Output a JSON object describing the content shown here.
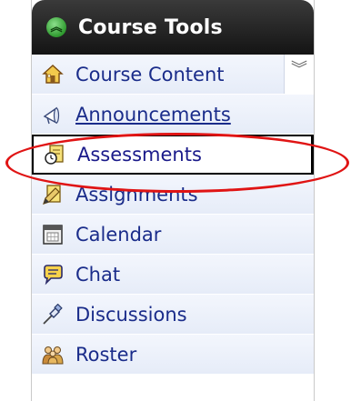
{
  "header": {
    "title": "Course Tools",
    "collapse_icon": "double-chevron-up-icon",
    "collapse_glyph": "︽"
  },
  "items": [
    {
      "label": "Course Content",
      "icon": "home-icon",
      "expand_icon": "double-chevron-down-icon",
      "expand_glyph": "︾"
    },
    {
      "label": "Announcements",
      "icon": "megaphone-icon"
    },
    {
      "label": "Assessments",
      "icon": "assessment-clock-icon"
    },
    {
      "label": "Assignments",
      "icon": "assignment-pencil-icon"
    },
    {
      "label": "Calendar",
      "icon": "calendar-icon"
    },
    {
      "label": "Chat",
      "icon": "chat-bubble-icon"
    },
    {
      "label": "Discussions",
      "icon": "pushpin-icon"
    },
    {
      "label": "Roster",
      "icon": "people-icon"
    }
  ],
  "colors": {
    "header_bg": "#1e1e1e",
    "link_blue": "#1a2c8a",
    "highlight_red": "#e01414",
    "collapse_green": "#2f9a2f"
  }
}
